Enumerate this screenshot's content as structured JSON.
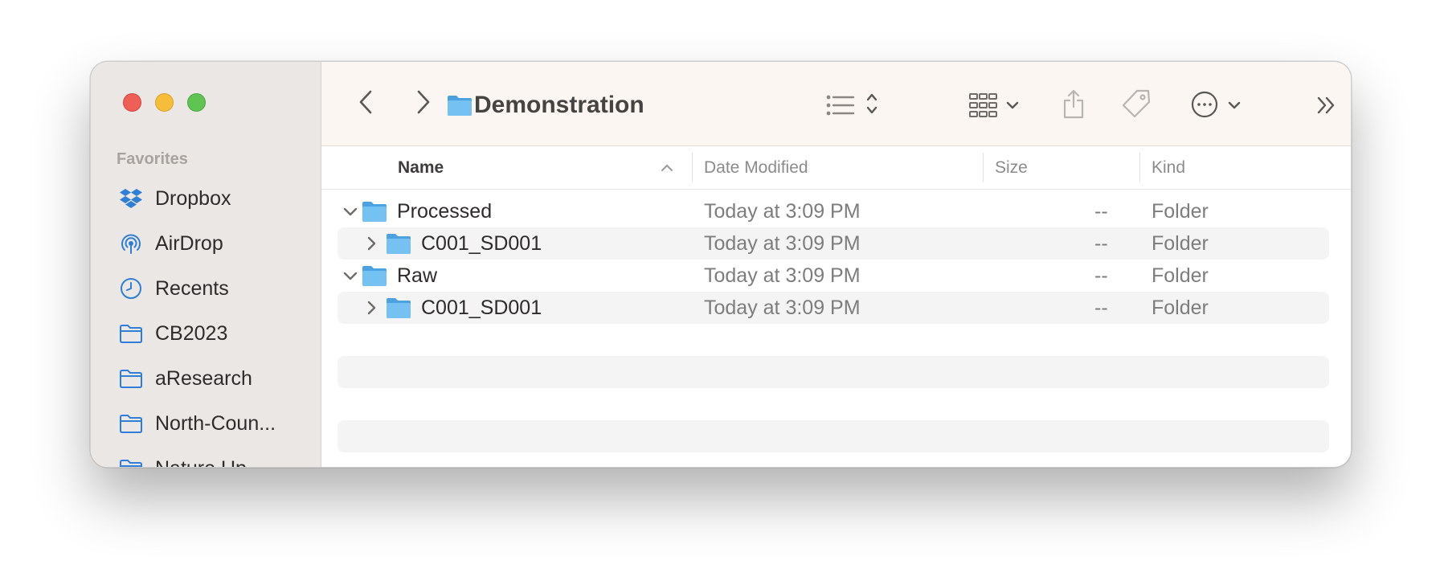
{
  "window": {
    "title": "Demonstration"
  },
  "sidebar": {
    "section_label": "Favorites",
    "items": [
      {
        "label": "Dropbox",
        "icon": "dropbox-icon"
      },
      {
        "label": "AirDrop",
        "icon": "airdrop-icon"
      },
      {
        "label": "Recents",
        "icon": "clock-icon"
      },
      {
        "label": "CB2023",
        "icon": "folder-icon"
      },
      {
        "label": "aResearch",
        "icon": "folder-icon"
      },
      {
        "label": "North-Coun...",
        "icon": "folder-icon"
      },
      {
        "label": "Nature Up...",
        "icon": "folder-icon"
      }
    ]
  },
  "columns": {
    "name": "Name",
    "date": "Date Modified",
    "size": "Size",
    "kind": "Kind"
  },
  "rows": [
    {
      "name": "Processed",
      "date": "Today at 3:09 PM",
      "size": "--",
      "kind": "Folder",
      "expanded": true,
      "level": 0
    },
    {
      "name": "C001_SD001",
      "date": "Today at 3:09 PM",
      "size": "--",
      "kind": "Folder",
      "expanded": false,
      "level": 1
    },
    {
      "name": "Raw",
      "date": "Today at 3:09 PM",
      "size": "--",
      "kind": "Folder",
      "expanded": true,
      "level": 0
    },
    {
      "name": "C001_SD001",
      "date": "Today at 3:09 PM",
      "size": "--",
      "kind": "Folder",
      "expanded": false,
      "level": 1
    }
  ],
  "colors": {
    "folder_blue": "#5db2ea",
    "accent_blue": "#2f7ed8",
    "close": "#ee5f58",
    "minimize": "#f6bd3b",
    "zoom": "#5fc454"
  }
}
